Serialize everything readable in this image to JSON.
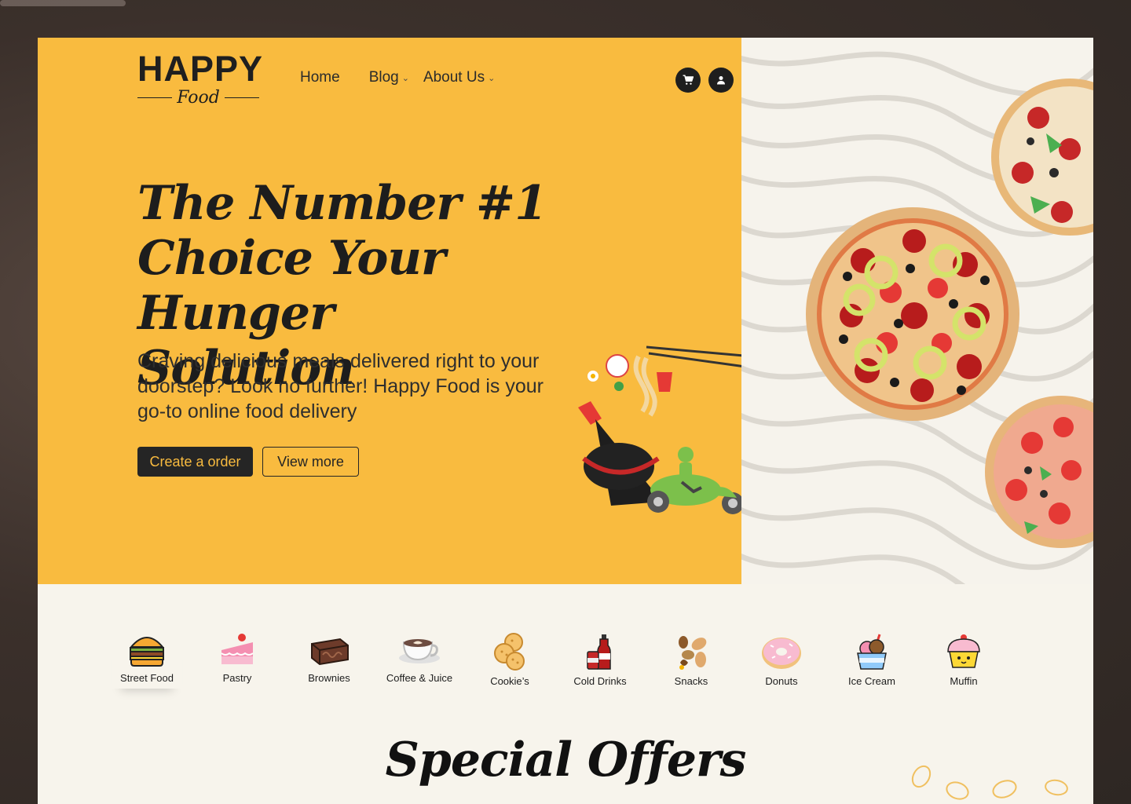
{
  "brand": {
    "name": "HAPPY",
    "sub": "Food"
  },
  "nav": {
    "home": "Home",
    "blog": "Blog",
    "about": "About Us"
  },
  "icons": {
    "cart": "cart-icon",
    "user": "user-icon",
    "chevron": "chevron-down-icon"
  },
  "hero": {
    "headline_1": "The Number #1",
    "headline_2": "Choice Your Hunger",
    "headline_3": "Solution",
    "subtext": "Craving delicious meals delivered right to your doorstep? Look no further! Happy Food is your go-to online food delivery",
    "primary_btn": "Create a order",
    "secondary_btn": "View more"
  },
  "categories": [
    {
      "label": "Street Food",
      "icon": "burger-icon"
    },
    {
      "label": "Pastry",
      "icon": "cake-icon"
    },
    {
      "label": "Brownies",
      "icon": "brownie-icon"
    },
    {
      "label": "Coffee & Juice",
      "icon": "coffee-icon"
    },
    {
      "label": "Cookie’s",
      "icon": "cookie-icon"
    },
    {
      "label": "Cold Drinks",
      "icon": "soda-icon"
    },
    {
      "label": "Snacks",
      "icon": "nuts-icon"
    },
    {
      "label": "Donuts",
      "icon": "donut-icon"
    },
    {
      "label": "Ice Cream",
      "icon": "ice-cream-icon"
    },
    {
      "label": "Muffin",
      "icon": "muffin-icon"
    }
  ],
  "section_title": "Special Offers",
  "colors": {
    "accent": "#f9bb3f",
    "dark": "#1e1e1e",
    "cream": "#f7f4ec"
  }
}
